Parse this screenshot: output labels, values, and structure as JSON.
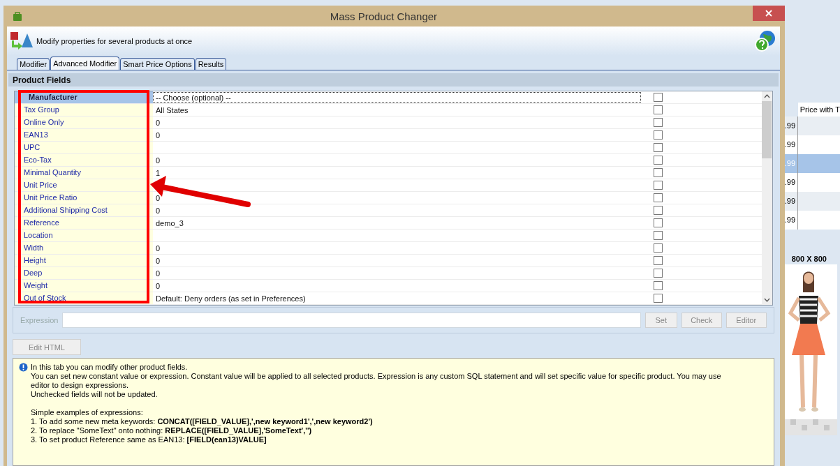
{
  "window": {
    "title": "Mass Product Changer"
  },
  "header": {
    "text": "Modify properties for several products at once"
  },
  "tabs": [
    {
      "label": "Modifier",
      "selected": false
    },
    {
      "label": "Advanced Modifier",
      "selected": true
    },
    {
      "label": "Smart Price Options",
      "selected": false
    },
    {
      "label": "Results",
      "selected": false
    }
  ],
  "section_title": "Product Fields",
  "fields": [
    {
      "name": "Manufacturer",
      "value": "-- Choose (optional) --",
      "checked": false,
      "selected": true
    },
    {
      "name": "Tax Group",
      "value": "All States",
      "checked": false,
      "selected": false
    },
    {
      "name": "Online Only",
      "value": "0",
      "checked": false,
      "selected": false
    },
    {
      "name": "EAN13",
      "value": "0",
      "checked": false,
      "selected": false
    },
    {
      "name": "UPC",
      "checked": false,
      "selected": false
    },
    {
      "name": "Eco-Tax",
      "value": "0",
      "checked": false,
      "selected": false
    },
    {
      "name": "Minimal Quantity",
      "value": "1",
      "checked": false,
      "selected": false
    },
    {
      "name": "Unit Price",
      "checked": false,
      "selected": false
    },
    {
      "name": "Unit Price Ratio",
      "value": "0",
      "checked": false,
      "selected": false
    },
    {
      "name": "Additional Shipping Cost",
      "value": "0",
      "checked": false,
      "selected": false
    },
    {
      "name": "Reference",
      "value": "demo_3",
      "checked": false,
      "selected": false
    },
    {
      "name": "Location",
      "checked": false,
      "selected": false
    },
    {
      "name": "Width",
      "value": "0",
      "checked": false,
      "selected": false
    },
    {
      "name": "Height",
      "value": "0",
      "checked": false,
      "selected": false
    },
    {
      "name": "Deep",
      "value": "0",
      "checked": false,
      "selected": false
    },
    {
      "name": "Weight",
      "value": "0",
      "checked": false,
      "selected": false
    },
    {
      "name": "Out of Stock",
      "value": "Default: Deny orders (as set in Preferences)",
      "checked": false,
      "selected": false
    }
  ],
  "expression": {
    "label": "Expression",
    "disabled": true
  },
  "expression_buttons": [
    {
      "label": "Set",
      "disabled": true
    },
    {
      "label": "Check",
      "disabled": true
    },
    {
      "label": "Editor",
      "disabled": true
    }
  ],
  "edit_html_button": {
    "label": "Edit HTML",
    "disabled": true
  },
  "help": {
    "paragraphs": [
      [
        "In this tab you can modify other product fields.",
        "You can set new constant value or expression. Constant value will be applied to all selected products. Expression is any custom SQL statement and will set specific value for specific product. You may use editor to design expressions.",
        "Unchecked fields will not be updated."
      ],
      [
        "Simple examples of expressions:",
        "1. To add some new meta keywords: **CONCAT([FIELD_VALUE],',new keyword1',',new keyword2')**",
        "2. To replace \"SomeText\" onto nothing: **REPLACE([FIELD_VALUE],'SomeText','')**",
        "3. To set product Reference same as EAN13: **[FIELD(ean13)VALUE]**"
      ]
    ]
  },
  "background": {
    "column_header": "Price with T",
    "rows": [
      {
        "value": ".99",
        "selected": false
      },
      {
        "value": ".99",
        "selected": false
      },
      {
        "value": ".99",
        "selected": true
      },
      {
        "value": ".99",
        "selected": false
      },
      {
        "value": ".99",
        "selected": false
      },
      {
        "value": ".99",
        "selected": false
      }
    ],
    "image_label": "800 X 800"
  }
}
